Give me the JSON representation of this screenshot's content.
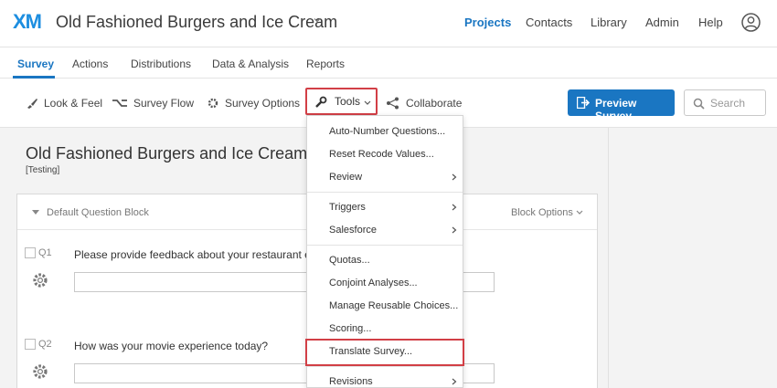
{
  "header": {
    "logo": "XM",
    "project_title": "Old Fashioned Burgers and Ice Cream",
    "nav": [
      "Projects",
      "Contacts",
      "Library",
      "Admin",
      "Help"
    ]
  },
  "tabs": [
    "Survey",
    "Actions",
    "Distributions",
    "Data & Analysis",
    "Reports"
  ],
  "toolbar": {
    "look_feel": "Look & Feel",
    "survey_flow": "Survey Flow",
    "survey_options": "Survey Options",
    "tools": "Tools",
    "collaborate": "Collaborate",
    "preview": "Preview Survey",
    "search_placeholder": "Search"
  },
  "survey": {
    "title": "Old Fashioned Burgers and Ice Cream",
    "status": "[Testing]",
    "block_name": "Default Question Block",
    "block_options": "Block Options",
    "questions": [
      {
        "num": "Q1",
        "text": "Please provide feedback about your restaurant e"
      },
      {
        "num": "Q2",
        "text": "How was your movie experience today?"
      }
    ]
  },
  "tools_menu": {
    "items": [
      "Auto-Number Questions...",
      "Reset Recode Values...",
      "Review",
      "Triggers",
      "Salesforce",
      "Quotas...",
      "Conjoint Analyses...",
      "Manage Reusable Choices...",
      "Scoring...",
      "Translate Survey...",
      "Revisions"
    ]
  },
  "colors": {
    "accent": "#1a76c2",
    "highlight": "#d23f46",
    "logo": "#1d8ee0"
  }
}
